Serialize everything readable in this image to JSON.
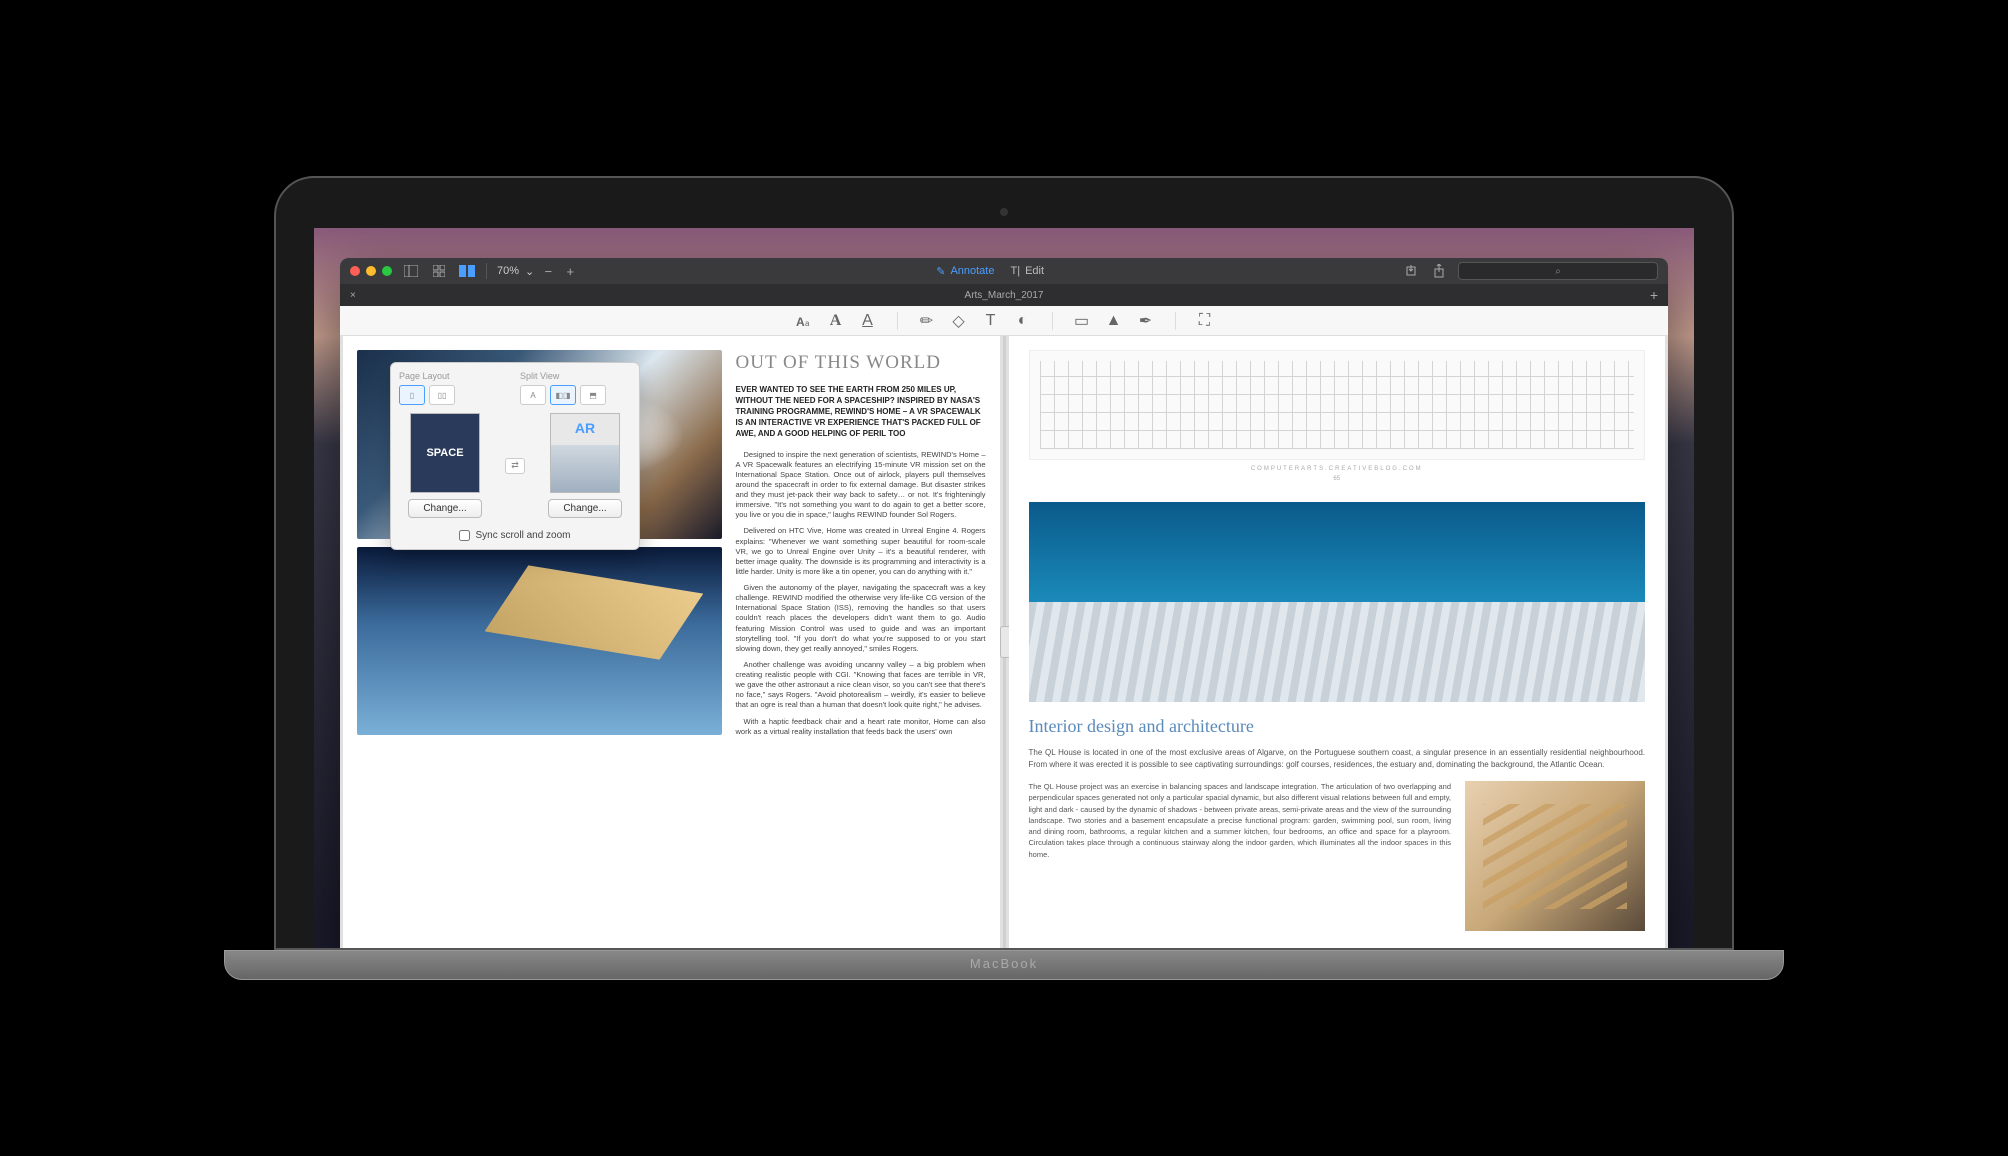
{
  "device": {
    "label": "MacBook"
  },
  "window": {
    "zoom": "70%",
    "modes": {
      "annotate": "Annotate",
      "edit": "Edit"
    },
    "tab_title": "Arts_March_2017"
  },
  "popover": {
    "page_layout_label": "Page Layout",
    "split_view_label": "Split View",
    "thumb_a_text": "SPACE",
    "thumb_b_text": "AR",
    "change_a": "Change...",
    "change_b": "Change...",
    "sync_label": "Sync scroll and zoom"
  },
  "left_pane": {
    "headline": "OUT OF THIS WORLD",
    "lead": "EVER WANTED TO SEE THE EARTH FROM 250 MILES UP, WITHOUT THE NEED FOR A SPACESHIP? INSPIRED BY NASA'S TRAINING PROGRAMME, REWIND'S HOME – A VR SPACEWALK IS AN INTERACTIVE VR EXPERIENCE THAT'S PACKED FULL OF AWE, AND A GOOD HELPING OF PERIL TOO",
    "p1": "Designed to inspire the next generation of scientists, REWIND's Home – A VR Spacewalk features an electrifying 15-minute VR mission set on the International Space Station. Once out of airlock, players pull themselves around the spacecraft in order to fix external damage. But disaster strikes and they must jet-pack their way back to safety… or not. It's frighteningly immersive. \"It's not something you want to do again to get a better score, you live or you die in space,\" laughs REWIND founder Sol Rogers.",
    "p2": "Delivered on HTC Vive, Home was created in Unreal Engine 4. Rogers explains: \"Whenever we want something super beautiful for room-scale VR, we go to Unreal Engine over Unity – it's a beautiful renderer, with better image quality. The downside is its programming and interactivity is a little harder. Unity is more like a tin opener, you can do anything with it.\"",
    "p3": "Given the autonomy of the player, navigating the spacecraft was a key challenge. REWIND modified the otherwise very life-like CG version of the International Space Station (ISS), removing the handles so that users couldn't reach places the developers didn't want them to go. Audio featuring Mission Control was used to guide and was an important storytelling tool. \"If you don't do what you're supposed to or you start slowing down, they get really annoyed,\" smiles Rogers.",
    "p4": "Another challenge was avoiding uncanny valley – a big problem when creating realistic people with CGI. \"Knowing that faces are terrible in VR, we gave the other astronaut a nice clean visor, so you can't see that there's no face,\" says Rogers. \"Avoid photorealism – weirdly, it's easier to believe that an ogre is real than a human that doesn't look quite right,\" he advises.",
    "p5": "With a haptic feedback chair and a heart rate monitor, Home can also work as a virtual reality installation that feeds back the users' own"
  },
  "right_pane": {
    "footer_site": "COMPUTERARTS.CREATIVEBLOG.COM",
    "page_no": "65",
    "headline": "Interior design and architecture",
    "intro": "The QL House is located in one of the most exclusive areas of Algarve, on the Portuguese southern coast, a singular presence in an essentially residential neighbourhood. From where it was erected it is possible to see captivating surroundings: golf courses, residences, the estuary and, dominating the background, the Atlantic Ocean.",
    "col": "The QL House project was an exercise in balancing spaces and landscape integration. The articulation of two overlapping and perpendicular spaces generated not only a particular spacial dynamic, but also different visual relations between full and empty, light and dark - caused by the dynamic of shadows - between private areas, semi-private areas and the view of the surrounding landscape. Two stories and a basement encapsulate a precise functional program: garden, swimming pool, sun room, living and dining room, bathrooms, a regular kitchen and a summer kitchen, four bedrooms, an office and space for a playroom. Circulation takes place through a continuous stairway along the indoor garden, which illuminates all the indoor spaces in this home."
  }
}
